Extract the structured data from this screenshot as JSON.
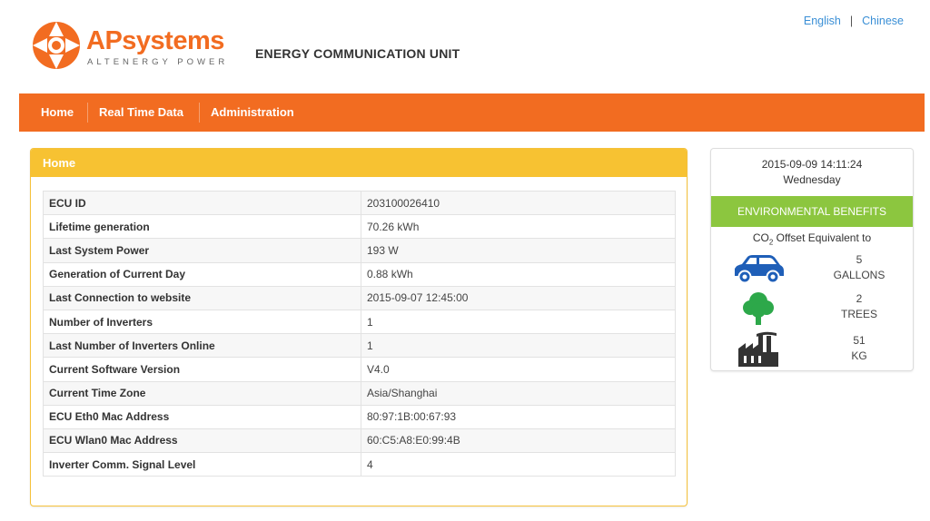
{
  "header": {
    "brand_prefix": "AP",
    "brand_suffix": "systems",
    "tagline": "ALTENERGY POWER",
    "title": "ENERGY COMMUNICATION UNIT",
    "lang_english": "English",
    "lang_sep": "|",
    "lang_chinese": "Chinese"
  },
  "nav": {
    "home": "Home",
    "realtime": "Real Time Data",
    "admin": "Administration"
  },
  "panel": {
    "title": "Home",
    "rows": [
      {
        "key": "ECU ID",
        "value": "203100026410"
      },
      {
        "key": "Lifetime generation",
        "value": "70.26 kWh"
      },
      {
        "key": "Last System Power",
        "value": "193 W"
      },
      {
        "key": "Generation of Current Day",
        "value": "0.88 kWh"
      },
      {
        "key": "Last Connection to website",
        "value": "2015-09-07 12:45:00"
      },
      {
        "key": "Number of Inverters",
        "value": "1"
      },
      {
        "key": "Last Number of Inverters Online",
        "value": "1"
      },
      {
        "key": "Current Software Version",
        "value": "V4.0"
      },
      {
        "key": "Current Time Zone",
        "value": "Asia/Shanghai"
      },
      {
        "key": "ECU Eth0 Mac Address",
        "value": "80:97:1B:00:67:93"
      },
      {
        "key": "ECU Wlan0 Mac Address",
        "value": "60:C5:A8:E0:99:4B"
      },
      {
        "key": "Inverter Comm. Signal Level",
        "value": "4"
      }
    ]
  },
  "side": {
    "datetime": "2015-09-09 14:11:24",
    "weekday": "Wednesday",
    "benefits_title": "ENVIRONMENTAL BENEFITS",
    "co2_prefix": "CO",
    "co2_sub": "2",
    "co2_suffix": " Offset Equivalent to",
    "benefits": [
      {
        "icon": "car-icon",
        "value": "5",
        "unit": "GALLONS"
      },
      {
        "icon": "tree-icon",
        "value": "2",
        "unit": "TREES"
      },
      {
        "icon": "factory-icon",
        "value": "51",
        "unit": "KG"
      }
    ]
  },
  "colors": {
    "brand_orange": "#f26c21",
    "panel_yellow": "#f7c232",
    "env_green": "#8cc63f",
    "car_blue": "#1f5fb8",
    "tree_green": "#2da84a",
    "factory_dark": "#333333",
    "link_blue": "#3a8fd6"
  }
}
